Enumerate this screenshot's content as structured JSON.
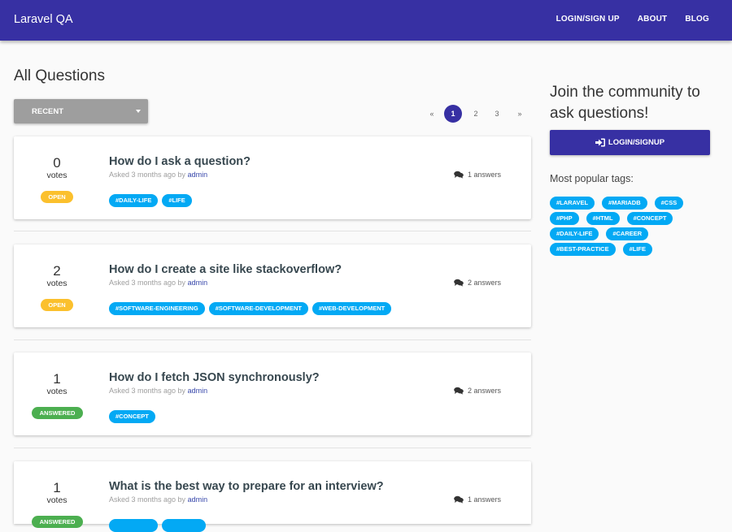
{
  "header": {
    "brand": "Laravel QA",
    "nav": [
      "LOGIN/SIGN UP",
      "ABOUT",
      "BLOG"
    ]
  },
  "main": {
    "title": "All Questions",
    "sort": {
      "selected": "RECENT"
    },
    "pagination": {
      "prev": "«",
      "pages": [
        "1",
        "2",
        "3"
      ],
      "next": "»",
      "current": "1"
    },
    "votes_label": "votes",
    "questions": [
      {
        "votes": "0",
        "status": "OPEN",
        "title": "How do I ask a question?",
        "asked": "Asked 3 months ago by",
        "author": "admin",
        "answers": "1 answers",
        "tags": [
          "#DAILY-LIFE",
          "#LIFE"
        ]
      },
      {
        "votes": "2",
        "status": "OPEN",
        "title": "How do I create a site like stackoverflow?",
        "asked": "Asked 3 months ago by",
        "author": "admin",
        "answers": "2 answers",
        "tags": [
          "#SOFTWARE-ENGINEERING",
          "#SOFTWARE-DEVELOPMENT",
          "#WEB-DEVELOPMENT"
        ]
      },
      {
        "votes": "1",
        "status": "ANSWERED",
        "title": "How do I fetch JSON synchronously?",
        "asked": "Asked 3 months ago by",
        "author": "admin",
        "answers": "2 answers",
        "tags": [
          "#CONCEPT"
        ]
      },
      {
        "votes": "1",
        "status": "ANSWERED",
        "title": "What is the best way to prepare for an interview?",
        "asked": "Asked 3 months ago by",
        "author": "admin",
        "answers": "1 answers",
        "tags": [
          "",
          ""
        ]
      }
    ]
  },
  "sidebar": {
    "heading": "Join the community to ask questions!",
    "login_button": "LOGIN/SIGNUP",
    "popular_label": "Most popular tags:",
    "tags": [
      "#LARAVEL",
      "#MARIADB",
      "#CSS",
      "#PHP",
      "#HTML",
      "#CONCEPT",
      "#DAILY-LIFE",
      "#CAREER",
      "#BEST-PRACTICE",
      "#LIFE"
    ]
  },
  "colors": {
    "primary": "#3730a3",
    "tag": "#03a9f4",
    "open": "#fbc02d",
    "answered": "#4caf50",
    "dropdown": "#9e9e9e"
  },
  "icons": {
    "answers": "comments-icon",
    "login": "sign-in-icon",
    "dropdown": "caret-down-icon"
  }
}
